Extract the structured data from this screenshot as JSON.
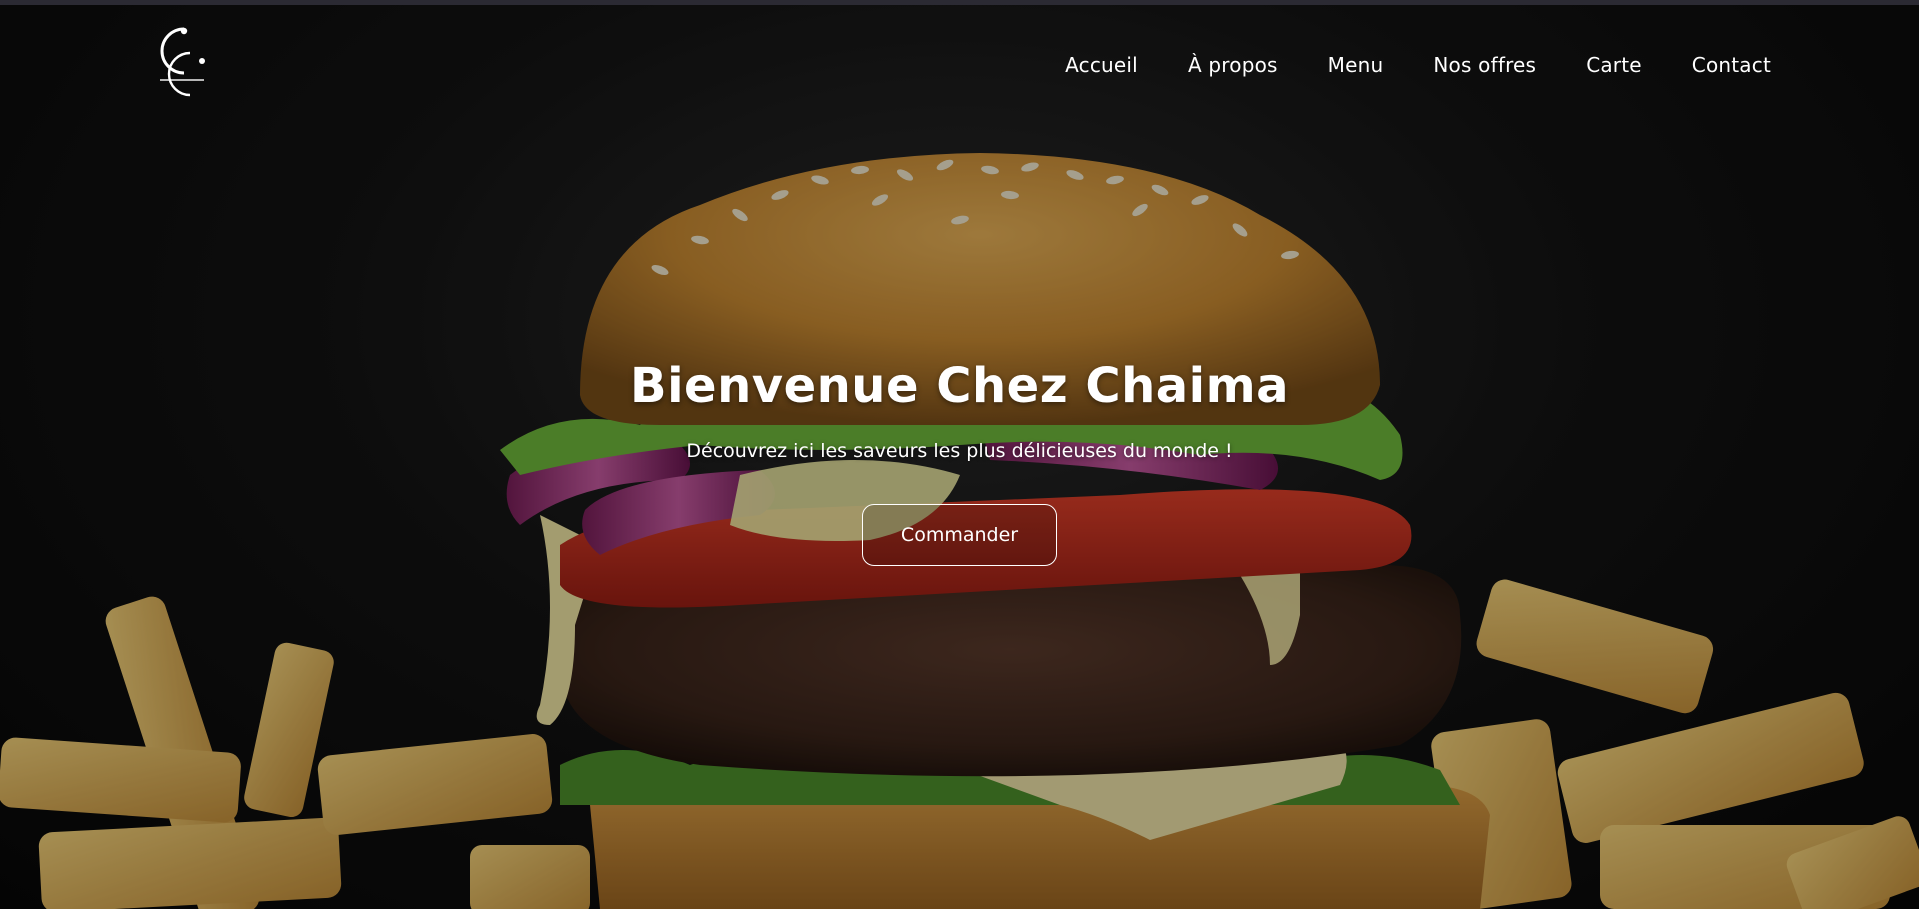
{
  "header": {
    "logo_icon": "chaima-monogram-logo",
    "nav": [
      {
        "label": "Accueil"
      },
      {
        "label": "À propos"
      },
      {
        "label": "Menu"
      },
      {
        "label": "Nos offres"
      },
      {
        "label": "Carte"
      },
      {
        "label": "Contact"
      }
    ]
  },
  "hero": {
    "background_image": "burger-and-fries-photo",
    "title": "Bienvenue Chez Chaima",
    "subtitle": "Découvrez ici les saveurs les plus délicieuses du monde !",
    "cta_label": "Commander"
  },
  "colors": {
    "text": "#ffffff",
    "background": "#0b0b0b",
    "topbar": "#2b2a33"
  }
}
